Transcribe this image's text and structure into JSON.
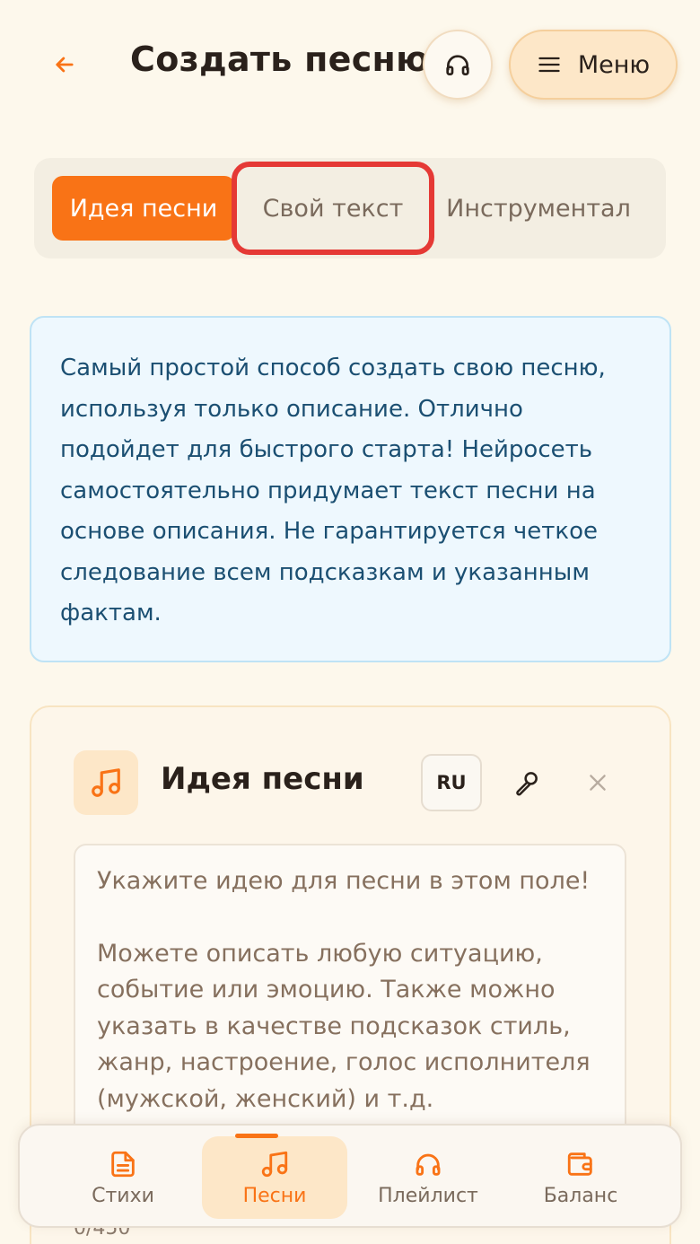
{
  "header": {
    "title": "Создать песню",
    "menu_label": "Меню",
    "back_icon": "arrow-left-icon",
    "headphones_icon": "headphones-icon",
    "menu_icon": "hamburger-icon"
  },
  "tabs": [
    {
      "label": "Идея песни",
      "active": true
    },
    {
      "label": "Свой текст",
      "active": false,
      "highlighted": true
    },
    {
      "label": "Инструментал",
      "active": false
    }
  ],
  "info": {
    "text": "Самый простой способ создать свою песню, используя только описание. Отлично подойдет для быстрого старта! Нейросеть самостоятельно придумает текст песни на основе описания. Не гарантируется четкое следование всем подсказкам и указанным фактам."
  },
  "card": {
    "icon": "music-note-icon",
    "title": "Идея песни",
    "lang_label": "RU",
    "mic_icon": "microphone-icon",
    "close_icon": "close-icon",
    "placeholder_line1": "Укажите идею для песни в этом поле!",
    "placeholder_line2": "Можете описать любую ситуацию, событие или эмоцию. Также можно указать в качестве подсказок стиль, жанр, настроение, голос исполнителя (мужской, женский) и т.д.",
    "char_count": "0/450"
  },
  "bottom_nav": [
    {
      "label": "Стихи",
      "icon": "document-icon",
      "active": false
    },
    {
      "label": "Песни",
      "icon": "music-note-icon",
      "active": true
    },
    {
      "label": "Плейлист",
      "icon": "headphones-icon",
      "active": false
    },
    {
      "label": "Баланс",
      "icon": "wallet-icon",
      "active": false
    }
  ],
  "colors": {
    "accent": "#f97316",
    "background": "#fdf8ec",
    "info_bg": "#eef8fe",
    "info_text": "#1b4f72",
    "highlight": "#e53935"
  }
}
